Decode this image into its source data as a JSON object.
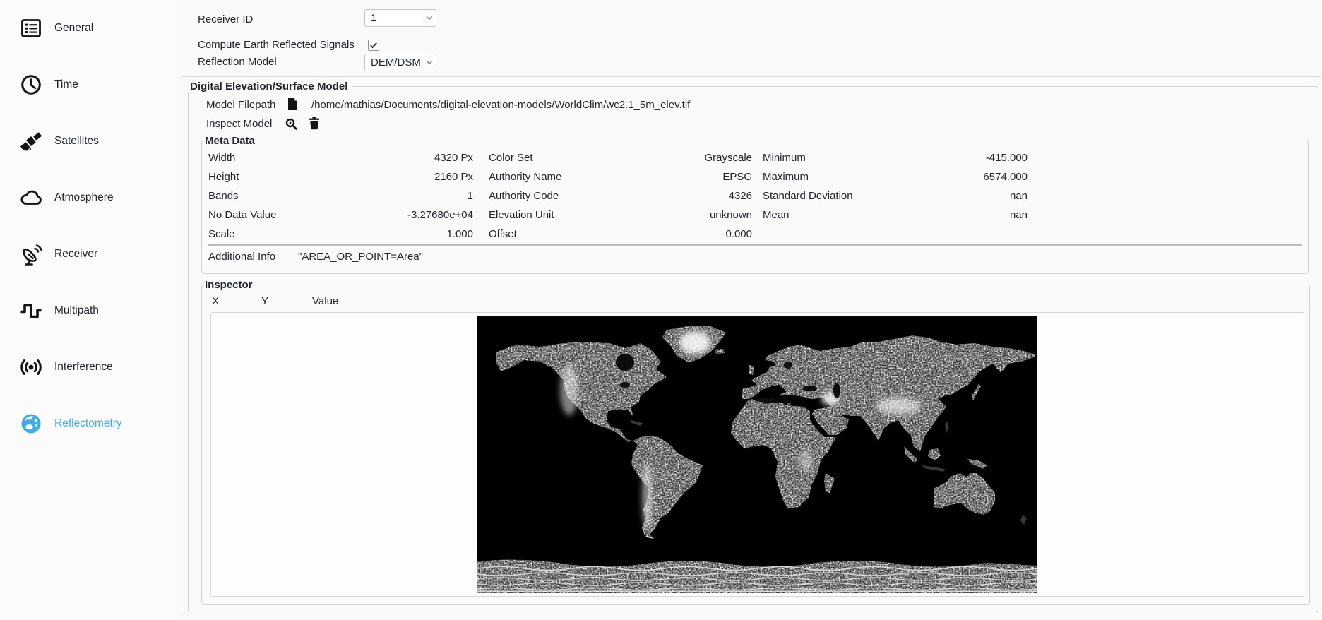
{
  "window": {
    "background": "#fafafa",
    "accent": "#3daee9"
  },
  "sidebar": {
    "items": [
      {
        "label": "General",
        "icon": "list-form-icon",
        "active": false
      },
      {
        "label": "Time",
        "icon": "clock-icon",
        "active": false
      },
      {
        "label": "Satellites",
        "icon": "satellite-icon",
        "active": false
      },
      {
        "label": "Atmosphere",
        "icon": "cloud-icon",
        "active": false
      },
      {
        "label": "Receiver",
        "icon": "dish-antenna-icon",
        "active": false
      },
      {
        "label": "Multipath",
        "icon": "square-wave-icon",
        "active": false
      },
      {
        "label": "Interference",
        "icon": "radio-signal-icon",
        "active": false
      },
      {
        "label": "Reflectometry",
        "icon": "globe-icon",
        "active": true
      }
    ]
  },
  "form": {
    "receiver_id": {
      "label": "Receiver ID",
      "value": "1"
    },
    "compute_earth_reflected": {
      "label": "Compute Earth Reflected Signals",
      "checked": true
    },
    "reflection_model": {
      "label": "Reflection Model",
      "value": "DEM/DSM"
    }
  },
  "dem": {
    "title": "Digital Elevation/Surface Model",
    "model_filepath": {
      "label": "Model Filepath",
      "value": "/home/mathias/Documents/digital-elevation-models/WorldClim/wc2.1_5m_elev.tif"
    },
    "inspect_model": {
      "label": "Inspect Model"
    }
  },
  "meta": {
    "title": "Meta Data",
    "col1": [
      [
        "Width",
        "4320 Px"
      ],
      [
        "Height",
        "2160 Px"
      ],
      [
        "Bands",
        "1"
      ],
      [
        "No Data Value",
        "-3.27680e+04"
      ],
      [
        "Scale",
        "1.000"
      ]
    ],
    "col2": [
      [
        "Color Set",
        "Grayscale"
      ],
      [
        "Authority Name",
        "EPSG"
      ],
      [
        "Authority Code",
        "4326"
      ],
      [
        "Elevation Unit",
        "unknown"
      ],
      [
        "Offset",
        "0.000"
      ]
    ],
    "col3": [
      [
        "Minimum",
        "-415.000"
      ],
      [
        "Maximum",
        "6574.000"
      ],
      [
        "Standard Deviation",
        "nan"
      ],
      [
        "Mean",
        "nan"
      ]
    ],
    "additional_info": {
      "label": "Additional Info",
      "value": "\"AREA_OR_POINT=Area\""
    }
  },
  "inspector": {
    "title": "Inspector",
    "columns": [
      "X",
      "Y",
      "Value"
    ],
    "map_description": "grayscale world elevation map preview, black ocean"
  }
}
